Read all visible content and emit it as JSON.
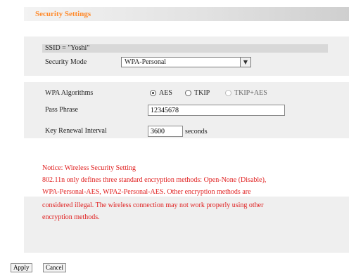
{
  "header": {
    "title": "Security Settings"
  },
  "ssid": {
    "label": "SSID = \"Yoshi\""
  },
  "security_mode": {
    "label": "Security Mode",
    "value": "WPA-Personal"
  },
  "wpa_algorithms": {
    "label": "WPA Algorithms",
    "options": [
      {
        "label": "AES",
        "checked": true
      },
      {
        "label": "TKIP",
        "checked": false
      },
      {
        "label": "TKIP+AES",
        "checked": false
      }
    ]
  },
  "pass_phrase": {
    "label": "Pass Phrase",
    "value": "12345678"
  },
  "key_renewal": {
    "label": "Key Renewal Interval",
    "value": "3600",
    "unit": "seconds"
  },
  "notice": {
    "lines": [
      "Notice: Wireless Security Setting",
      "802.11n only defines three standard encryption methods: Open-None (Disable),",
      "WPA-Personal-AES, WPA2-Personal-AES. Other encryption methods are",
      "considered illegal. The wireless connection may not work properly using other",
      "encryption methods."
    ]
  },
  "buttons": {
    "apply": "Apply",
    "cancel": "Cancel"
  }
}
